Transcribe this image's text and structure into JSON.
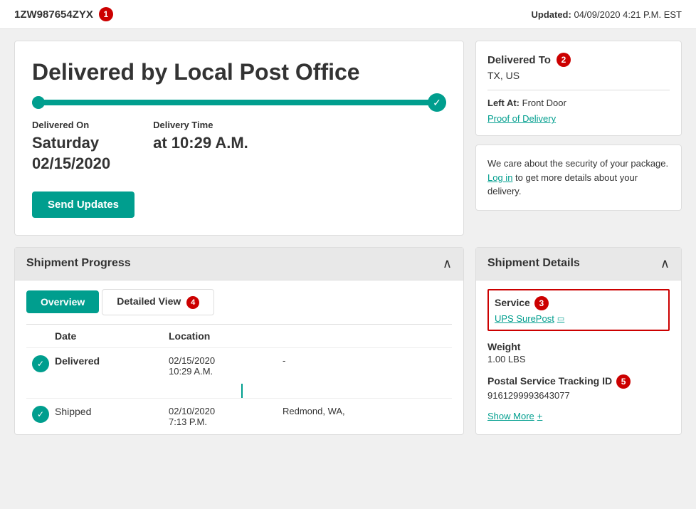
{
  "topbar": {
    "tracking_number": "1ZW987654ZYX",
    "badge1": "1",
    "updated_label": "Updated:",
    "updated_value": "04/09/2020 4:21 P.M. EST"
  },
  "delivery_card": {
    "title": "Delivered by Local Post Office",
    "delivered_on_label": "Delivered On",
    "delivered_on_value": "Saturday\n02/15/2020",
    "delivered_on_line1": "Saturday",
    "delivered_on_line2": "02/15/2020",
    "delivery_time_label": "Delivery Time",
    "delivery_time_value": "at 10:29 A.M.",
    "send_updates_btn": "Send Updates"
  },
  "right_panel": {
    "delivered_to": {
      "title": "Delivered To",
      "badge2": "2",
      "location": "TX, US",
      "left_at_label": "Left At:",
      "left_at_value": "Front Door",
      "proof_link": "Proof of Delivery"
    },
    "security_card": {
      "text_before": "We care about the security of your package.",
      "login_link": "Log in",
      "text_after": "to get more details about your delivery."
    }
  },
  "shipment_progress": {
    "section_title": "Shipment Progress",
    "tab_overview": "Overview",
    "tab_detailed": "Detailed View",
    "tab_badge4": "4",
    "table_headers": {
      "col1": "",
      "col2": "Date",
      "col3": "Location"
    },
    "rows": [
      {
        "status": "Delivered",
        "date_line1": "02/15/2020",
        "date_line2": "10:29 A.M.",
        "location": "-",
        "icon": "check",
        "bold": true
      },
      {
        "status": "Shipped",
        "date_line1": "02/10/2020",
        "date_line2": "7:13 P.M.",
        "location": "Redmond, WA,",
        "icon": "check",
        "bold": false
      }
    ]
  },
  "shipment_details": {
    "section_title": "Shipment Details",
    "badge3": "3",
    "badge5": "5",
    "service_label": "Service",
    "service_value": "UPS SurePost",
    "weight_label": "Weight",
    "weight_value": "1.00 LBS",
    "postal_tracking_label": "Postal Service Tracking ID",
    "postal_tracking_value": "9161299993643077",
    "show_more_link": "Show More",
    "plus": "+"
  }
}
